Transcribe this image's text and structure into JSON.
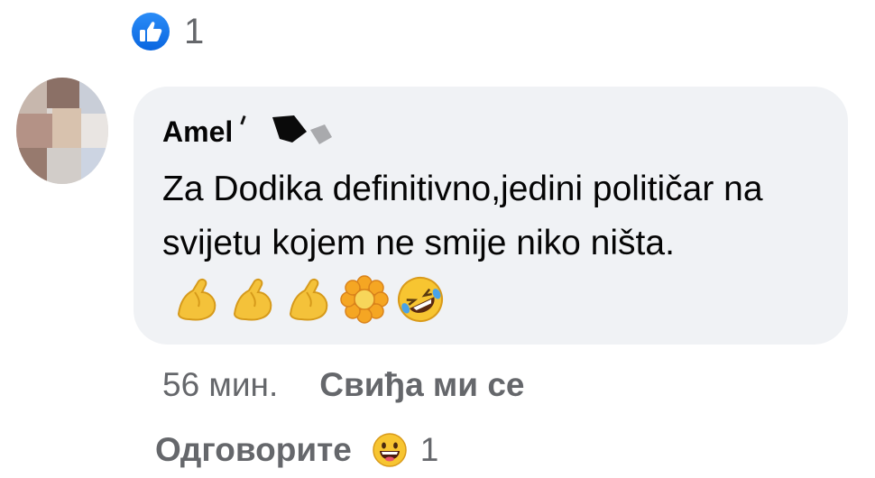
{
  "reaction_summary": {
    "count": "1",
    "icon": "thumbs-up-icon",
    "color": "#1877f2"
  },
  "comment": {
    "author": "Amel",
    "text": "Za Dodika definitivno,jedini političar na svijetu kojem ne smije niko ništa.",
    "emojis": [
      "flexed-biceps-icon",
      "flexed-biceps-icon",
      "flexed-biceps-icon",
      "flower-icon",
      "rolling-on-floor-laughing-icon"
    ]
  },
  "meta": {
    "time": "56 мин.",
    "like_label": "Свиђа ми се"
  },
  "reply": {
    "label": "Одговорите",
    "reaction_icon": "grinning-face-icon",
    "count": "1"
  }
}
